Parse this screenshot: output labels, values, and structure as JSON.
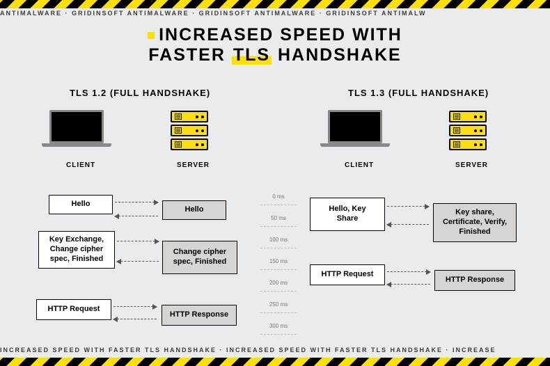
{
  "marquee_top": "ANTIMALWARE  ·  GRIDINSOFT ANTIMALWARE  ·  GRIDINSOFT ANTIMALWARE  ·  GRIDINSOFT ANTIMALW",
  "marquee_bot": "INCREASED SPEED WITH FASTER TLS HANDSHAKE  ·  INCREASED SPEED WITH FASTER TLS HANDSHAKE  ·  INCREASE",
  "title_line1": "INCREASED SPEED WITH",
  "title_line2_pre": "FASTER ",
  "title_line2_hl": "TLS",
  "title_line2_post": " HANDSHAKE",
  "tls12": {
    "header": "TLS 1.2 (FULL HANDSHAKE)",
    "client_label": "CLIENT",
    "server_label": "SERVER",
    "steps": [
      {
        "c": "Hello",
        "s": "Hello"
      },
      {
        "c": "Key Exchange, Change cipher spec, Finished",
        "s": "Change cipher spec, Finished"
      },
      {
        "c": "HTTP Request",
        "s": "HTTP Response"
      }
    ]
  },
  "tls13": {
    "header": "TLS 1.3 (FULL HANDSHAKE)",
    "client_label": "CLIENT",
    "server_label": "SERVER",
    "steps": [
      {
        "c": "Hello, Key Share",
        "s": "Key share, Certificate, Verify, Finished"
      },
      {
        "c": "HTTP Request",
        "s": "HTTP Response"
      }
    ]
  },
  "timeline": [
    "0 ms",
    "50 ms",
    "100 ms",
    "150 ms",
    "200 ms",
    "250 ms",
    "300 ms"
  ]
}
